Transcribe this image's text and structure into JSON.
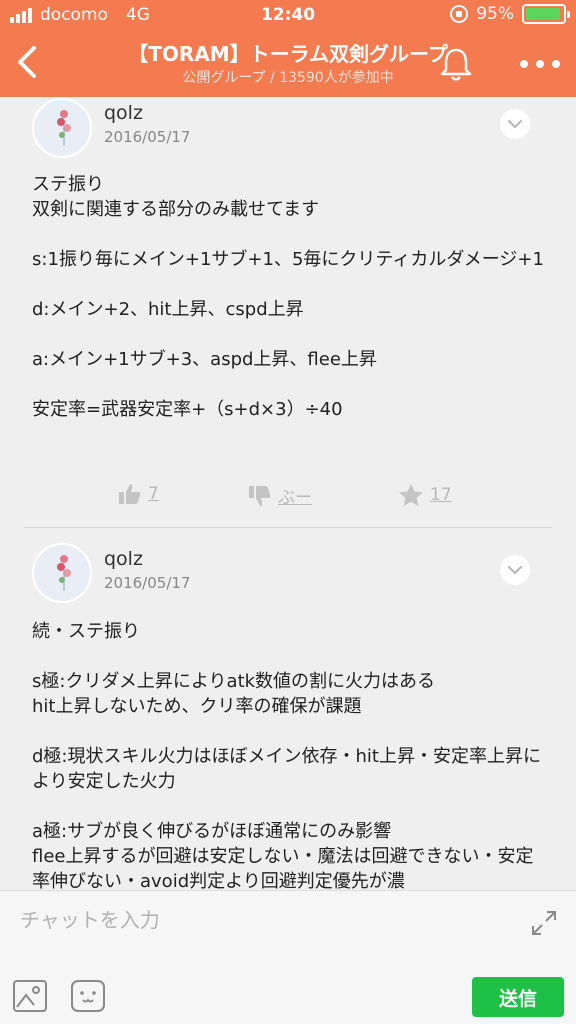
{
  "status_bar": {
    "carrier": "docomo",
    "network": "4G",
    "time": "12:40",
    "battery": "95%",
    "battery_level": 0.95
  },
  "nav": {
    "title": "【TORAM】トーラム双剣グループ",
    "subtitle": "公開グループ / 13590人が参加中"
  },
  "posts": [
    {
      "author": "qolz",
      "date": "2016/05/17",
      "paragraphs": [
        "ステ振り\n双剣に関連する部分のみ載せてます",
        "s:1振り毎にメイン+1サブ+1、5毎にクリティカルダメージ+1",
        "d:メイン+2、hit上昇、cspd上昇",
        "a:メイン+1サブ+3、aspd上昇、flee上昇",
        "安定率=武器安定率+（s+d×3）÷40"
      ],
      "likes": "7",
      "dislikes": "ぶー",
      "stars": "17"
    },
    {
      "author": "qolz",
      "date": "2016/05/17",
      "paragraphs": [
        "続・ステ振り",
        "s極:クリダメ上昇によりatk数値の割に火力はある\nhit上昇しないため、クリ率の確保が課題",
        "d極:現状スキル火力はほぼメイン依存・hit上昇・安定率上昇により安定した火力",
        "a極:サブが良く伸びるがほぼ通常にのみ影響\nflee上昇するが回避は安定しない・魔法は回避できない・安定率伸びない・avoid判定より回避判定優先が濃"
      ]
    }
  ],
  "composer": {
    "placeholder": "チャットを入力",
    "send_label": "送信"
  },
  "colors": {
    "header": "#f47a50",
    "send": "#1ec145",
    "battery": "#5bd55b"
  }
}
